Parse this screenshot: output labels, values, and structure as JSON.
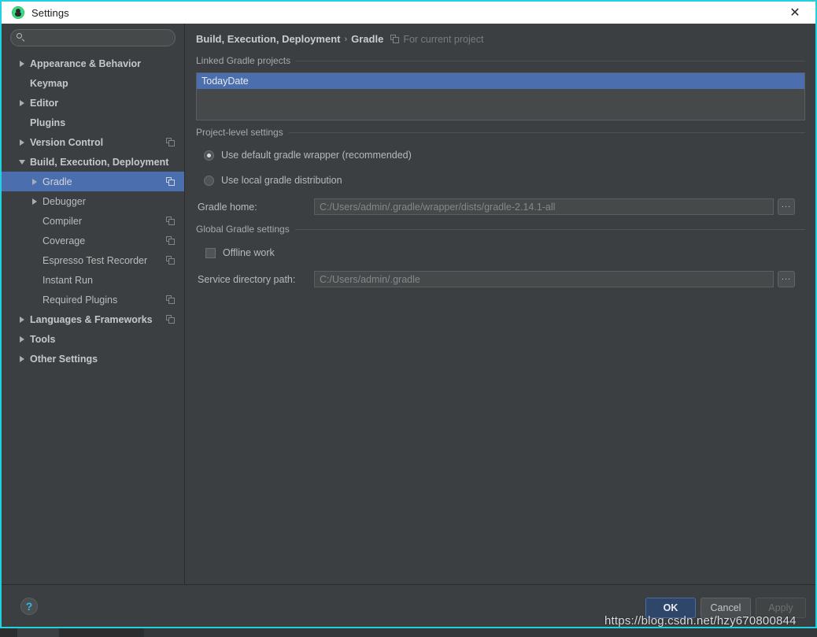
{
  "window": {
    "title": "Settings",
    "app_icon": "android-studio-icon",
    "close_icon": "close-icon",
    "accent_border": "#1fd2de"
  },
  "search": {
    "placeholder": "",
    "value": "",
    "icon": "search-icon"
  },
  "sidebar": {
    "items": [
      {
        "label": "Appearance & Behavior",
        "arrow": "right",
        "bold": true,
        "indent": 0,
        "scope_icon": false,
        "selected": false
      },
      {
        "label": "Keymap",
        "arrow": "none",
        "bold": true,
        "indent": 0,
        "scope_icon": false,
        "selected": false
      },
      {
        "label": "Editor",
        "arrow": "right",
        "bold": true,
        "indent": 0,
        "scope_icon": false,
        "selected": false
      },
      {
        "label": "Plugins",
        "arrow": "none",
        "bold": true,
        "indent": 0,
        "scope_icon": false,
        "selected": false
      },
      {
        "label": "Version Control",
        "arrow": "right",
        "bold": true,
        "indent": 0,
        "scope_icon": true,
        "selected": false
      },
      {
        "label": "Build, Execution, Deployment",
        "arrow": "down",
        "bold": true,
        "indent": 0,
        "scope_icon": false,
        "selected": false
      },
      {
        "label": "Gradle",
        "arrow": "right",
        "bold": false,
        "indent": 1,
        "scope_icon": true,
        "selected": true
      },
      {
        "label": "Debugger",
        "arrow": "right",
        "bold": false,
        "indent": 1,
        "scope_icon": false,
        "selected": false
      },
      {
        "label": "Compiler",
        "arrow": "none",
        "bold": false,
        "indent": 1,
        "scope_icon": true,
        "selected": false
      },
      {
        "label": "Coverage",
        "arrow": "none",
        "bold": false,
        "indent": 1,
        "scope_icon": true,
        "selected": false
      },
      {
        "label": "Espresso Test Recorder",
        "arrow": "none",
        "bold": false,
        "indent": 1,
        "scope_icon": true,
        "selected": false
      },
      {
        "label": "Instant Run",
        "arrow": "none",
        "bold": false,
        "indent": 1,
        "scope_icon": false,
        "selected": false
      },
      {
        "label": "Required Plugins",
        "arrow": "none",
        "bold": false,
        "indent": 1,
        "scope_icon": true,
        "selected": false
      },
      {
        "label": "Languages & Frameworks",
        "arrow": "right",
        "bold": true,
        "indent": 0,
        "scope_icon": true,
        "selected": false
      },
      {
        "label": "Tools",
        "arrow": "right",
        "bold": true,
        "indent": 0,
        "scope_icon": false,
        "selected": false
      },
      {
        "label": "Other Settings",
        "arrow": "right",
        "bold": true,
        "indent": 0,
        "scope_icon": false,
        "selected": false
      }
    ]
  },
  "breadcrumb": {
    "parent": "Build, Execution, Deployment",
    "separator": "›",
    "current": "Gradle",
    "scope_icon": "project-scope-icon",
    "scope_text": "For current project"
  },
  "main": {
    "linked_projects": {
      "group_title": "Linked Gradle projects",
      "items": [
        {
          "label": "TodayDate",
          "selected": true
        }
      ]
    },
    "project_level": {
      "group_title": "Project-level settings",
      "radios": [
        {
          "label": "Use default gradle wrapper (recommended)",
          "checked": true
        },
        {
          "label": "Use local gradle distribution",
          "checked": false
        }
      ],
      "gradle_home": {
        "label": "Gradle home:",
        "value": "C:/Users/admin/.gradle/wrapper/dists/gradle-2.14.1-all",
        "browse_label": "...",
        "browse_icon": "ellipsis-icon"
      }
    },
    "global_settings": {
      "group_title": "Global Gradle settings",
      "offline_work": {
        "label": "Offline work",
        "checked": false
      },
      "service_directory": {
        "label": "Service directory path:",
        "value": "C:/Users/admin/.gradle",
        "browse_label": "...",
        "browse_icon": "ellipsis-icon"
      }
    }
  },
  "footer": {
    "help_label": "?",
    "help_icon": "help-icon",
    "buttons": [
      {
        "label": "OK",
        "style": "primary"
      },
      {
        "label": "Cancel",
        "style": "normal"
      },
      {
        "label": "Apply",
        "style": "disabled"
      }
    ]
  },
  "watermark": {
    "text": "https://blog.csdn.net/hzy670800844"
  }
}
